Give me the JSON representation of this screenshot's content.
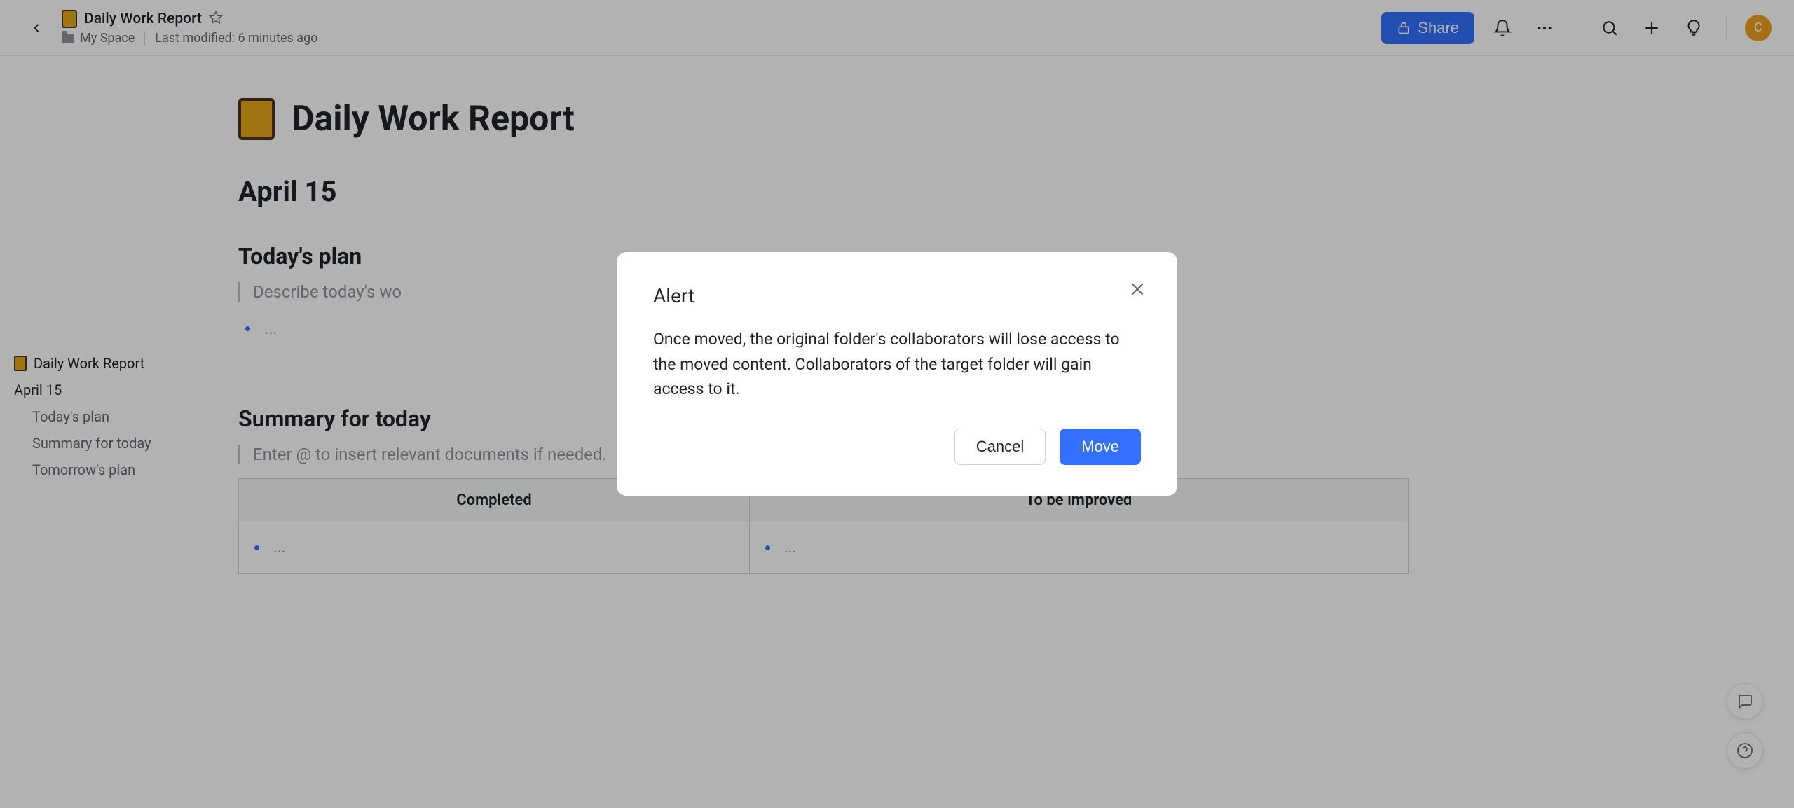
{
  "header": {
    "doc_title": "Daily Work Report",
    "breadcrumb_folder": "My Space",
    "last_modified": "Last modified: 6 minutes ago",
    "share_label": "Share",
    "avatar_initial": "C"
  },
  "sidebar": {
    "title": "Daily Work Report",
    "items": [
      {
        "label": "April 15",
        "level": 0
      },
      {
        "label": "Today's plan",
        "level": 1
      },
      {
        "label": "Summary for today",
        "level": 1
      },
      {
        "label": "Tomorrow's plan",
        "level": 1
      }
    ]
  },
  "doc": {
    "page_title": "Daily Work Report",
    "date_heading": "April 15",
    "plan_heading": "Today's plan",
    "plan_placeholder": "Describe today's wo",
    "bullet_placeholder": "...",
    "summary_heading": "Summary for today",
    "summary_placeholder": "Enter @ to insert relevant documents if needed.",
    "table": {
      "col1": "Completed",
      "col2": "To be improved",
      "cell1": "...",
      "cell2": "..."
    }
  },
  "modal": {
    "title": "Alert",
    "body": "Once moved, the original folder's collaborators will lose access to the moved content. Collaborators of the target folder will gain access to it.",
    "cancel_label": "Cancel",
    "confirm_label": "Move"
  }
}
